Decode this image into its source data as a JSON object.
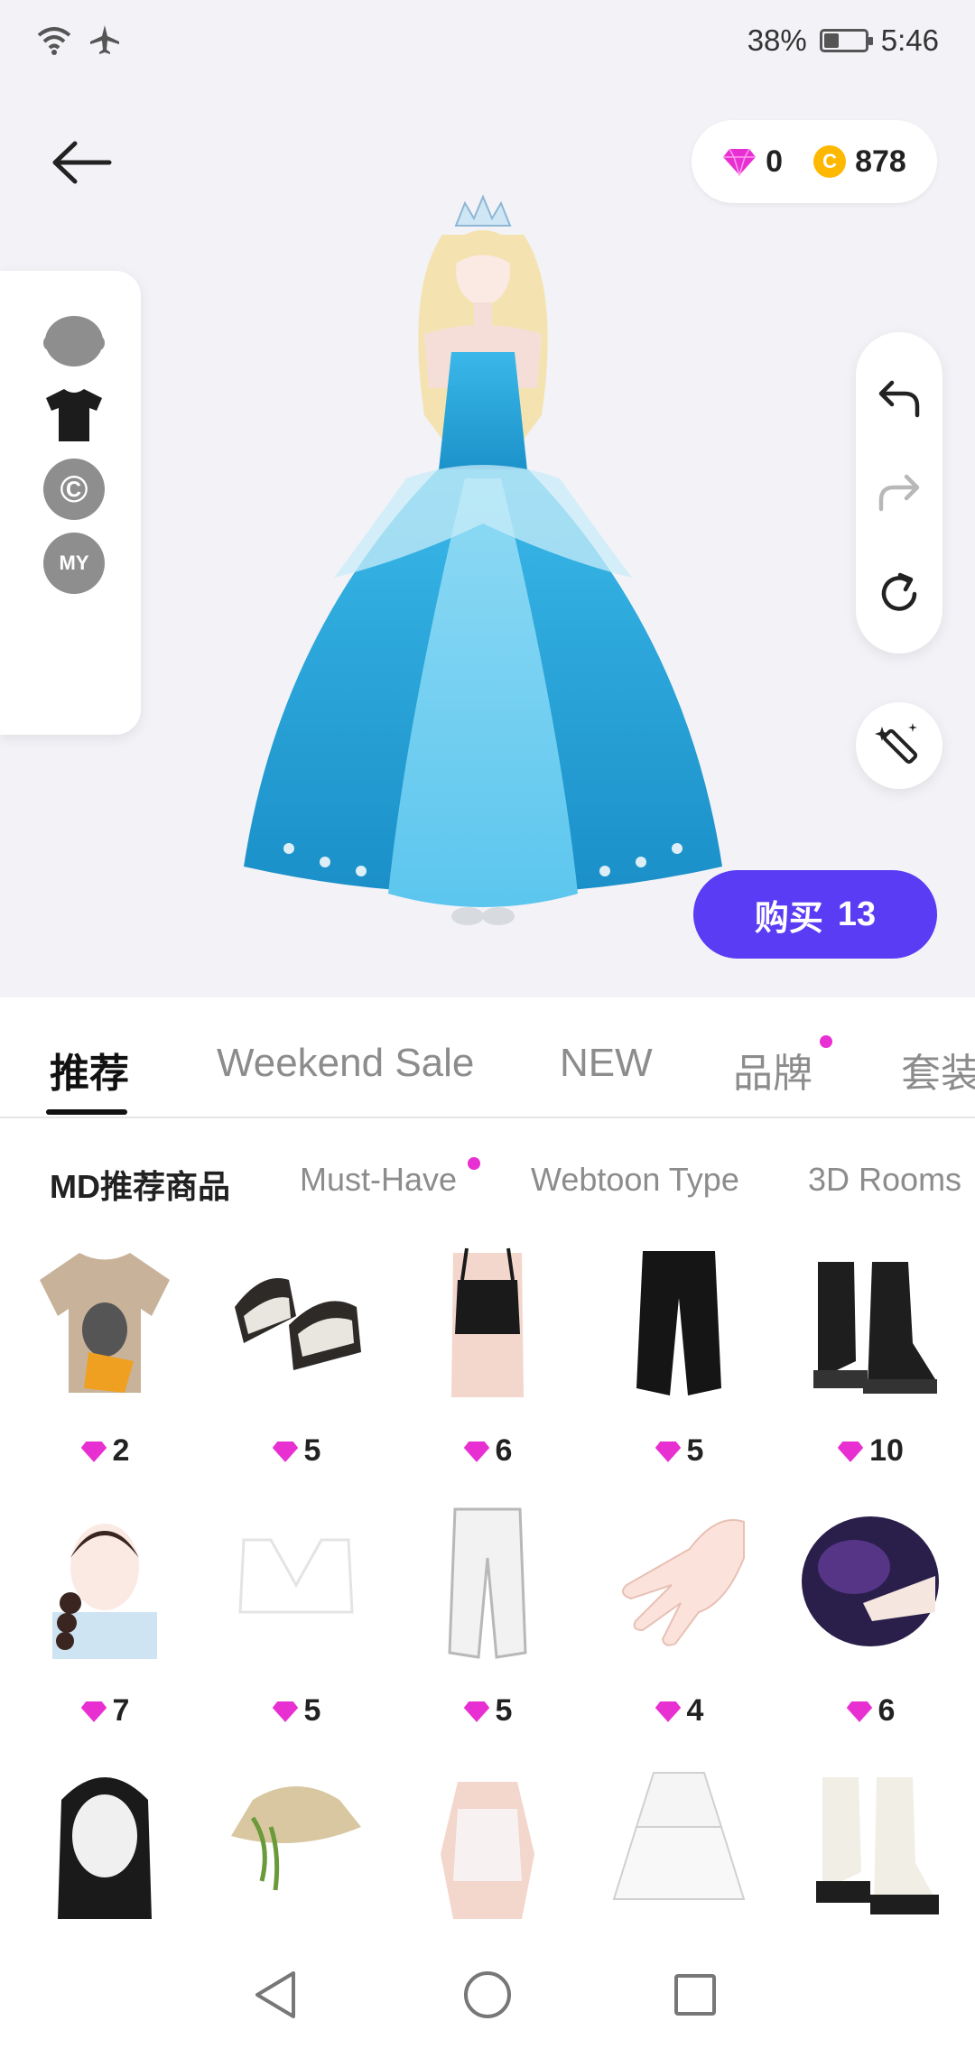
{
  "status_bar": {
    "battery": "38%",
    "time": "5:46",
    "battery_level": 0.38
  },
  "currency": {
    "gems": "0",
    "coins": "878",
    "coin_symbol": "C"
  },
  "side_menu": [
    {
      "name": "head",
      "icon": "head-icon"
    },
    {
      "name": "clothes",
      "icon": "tshirt-icon"
    },
    {
      "name": "creator",
      "icon": "copyright-icon",
      "symbol": "©"
    },
    {
      "name": "my",
      "icon": "my-icon",
      "label": "MY"
    }
  ],
  "buy_button": {
    "label": "购买",
    "count": "13"
  },
  "tabs": [
    {
      "label": "推荐",
      "active": true
    },
    {
      "label": "Weekend Sale"
    },
    {
      "label": "NEW"
    },
    {
      "label": "品牌",
      "dot": true
    },
    {
      "label": "套装"
    }
  ],
  "subtabs": [
    {
      "label": "MD推荐商品",
      "active": true
    },
    {
      "label": "Must-Have",
      "dot": true
    },
    {
      "label": "Webtoon Type"
    },
    {
      "label": "3D Rooms"
    }
  ],
  "items": [
    {
      "name": "graphic-tshirt",
      "price": "2"
    },
    {
      "name": "sneakers",
      "price": "5"
    },
    {
      "name": "black-crop-top",
      "price": "6"
    },
    {
      "name": "black-pants",
      "price": "5"
    },
    {
      "name": "platform-boots",
      "price": "10"
    },
    {
      "name": "braided-hair",
      "price": "7"
    },
    {
      "name": "white-bra-top",
      "price": "5"
    },
    {
      "name": "white-cargo-pants",
      "price": "5"
    },
    {
      "name": "nail-art",
      "price": "4"
    },
    {
      "name": "ring-accessory",
      "price": "6"
    },
    {
      "name": "long-black-hair",
      "price": ""
    },
    {
      "name": "straw-visor-hat",
      "price": ""
    },
    {
      "name": "lace-top",
      "price": ""
    },
    {
      "name": "white-tiered-skirt",
      "price": ""
    },
    {
      "name": "white-combat-boots",
      "price": ""
    }
  ],
  "colors": {
    "accent": "#5a3cf5",
    "gem": "#e82fd2",
    "coin": "#ffb800",
    "dress": "#1fa3d6"
  }
}
